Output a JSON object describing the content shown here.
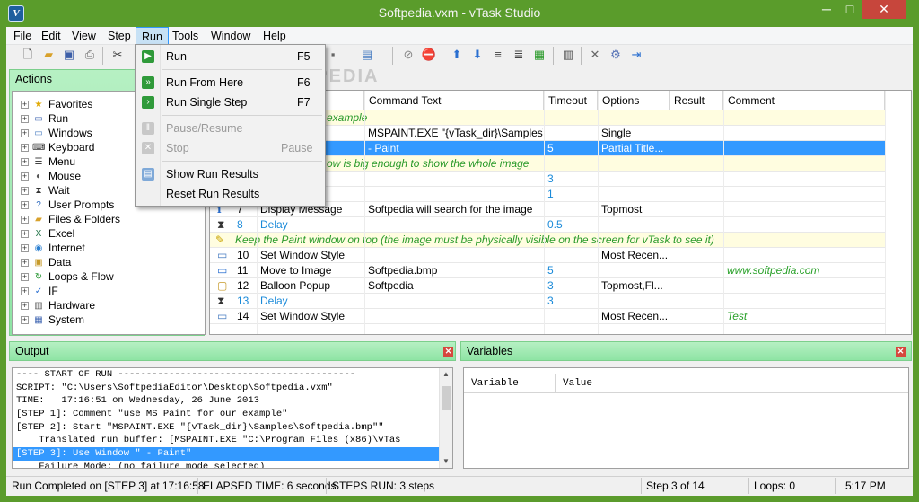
{
  "window": {
    "title": "Softpedia.vxm - vTask Studio",
    "min": "─",
    "max": "□",
    "close": "✕"
  },
  "menubar": [
    "File",
    "Edit",
    "View",
    "Step",
    "Run",
    "Tools",
    "Window",
    "Help"
  ],
  "run_menu": {
    "items": [
      {
        "label": "Run",
        "key": "F5"
      },
      {
        "label": "Run From Here",
        "key": "F6"
      },
      {
        "label": "Run Single Step",
        "key": "F7"
      },
      {
        "label": "Pause/Resume",
        "key": ""
      },
      {
        "label": "Stop",
        "key": "Pause"
      },
      {
        "label": "Show Run Results",
        "key": ""
      },
      {
        "label": "Reset Run Results",
        "key": ""
      }
    ]
  },
  "actions": {
    "title": "Actions",
    "items": [
      "Favorites",
      "Run",
      "Windows",
      "Keyboard",
      "Menu",
      "Mouse",
      "Wait",
      "User Prompts",
      "Files & Folders",
      "Excel",
      "Internet",
      "Data",
      "Loops & Flow",
      "IF",
      "Hardware",
      "System"
    ]
  },
  "grid": {
    "headers": [
      "Command Text",
      "Timeout",
      "Options",
      "Result",
      "Comment"
    ],
    "rows": [
      {
        "type": "comment",
        "text": "example"
      },
      {
        "num": "",
        "name": "",
        "cmd": "MSPAINT.EXE \"{vTask_dir}\\Samples\\...",
        "timeout": "",
        "options": "Single",
        "result": "",
        "comment": ""
      },
      {
        "num": "",
        "name": "",
        "cmd": " - Paint",
        "timeout": "5",
        "options": "Partial Title...",
        "result": "",
        "comment": "",
        "selected": true
      },
      {
        "type": "comment",
        "text": "ow is big enough to show the whole image"
      },
      {
        "num": "",
        "name": "",
        "cmd": "",
        "timeout": "3",
        "options": "",
        "result": "",
        "comment": ""
      },
      {
        "num": "",
        "name": "",
        "cmd": "",
        "timeout": "1",
        "options": "",
        "result": "",
        "comment": "",
        "blue": true
      },
      {
        "num": "7",
        "name": "Display Message",
        "cmd": "Softpedia will search for the image",
        "timeout": "",
        "options": "Topmost",
        "result": "",
        "comment": ""
      },
      {
        "num": "8",
        "name": "Delay",
        "cmd": "",
        "timeout": "0.5",
        "options": "",
        "result": "",
        "comment": "",
        "blue": true
      },
      {
        "type": "comment",
        "text": "Keep the Paint window on top (the image must be physically visible on the screen for vTask to see it)"
      },
      {
        "num": "10",
        "name": "Set Window Style",
        "cmd": "",
        "timeout": "",
        "options": "Most Recen...",
        "result": "",
        "comment": ""
      },
      {
        "num": "11",
        "name": "Move to Image",
        "cmd": "Softpedia.bmp",
        "timeout": "5",
        "options": "",
        "result": "",
        "comment": "www.softpedia.com"
      },
      {
        "num": "12",
        "name": "Balloon Popup",
        "cmd": "Softpedia",
        "timeout": "3",
        "options": "Topmost,Fl...",
        "result": "",
        "comment": ""
      },
      {
        "num": "13",
        "name": "Delay",
        "cmd": "",
        "timeout": "3",
        "options": "",
        "result": "",
        "comment": "",
        "blue": true
      },
      {
        "num": "14",
        "name": "Set Window Style",
        "cmd": "",
        "timeout": "",
        "options": "Most Recen...",
        "result": "",
        "comment": "Test"
      }
    ]
  },
  "output": {
    "title": "Output",
    "lines": [
      "---- START OF RUN ------------------------------------------",
      "SCRIPT: \"C:\\Users\\SoftpediaEditor\\Desktop\\Softpedia.vxm\"",
      "TIME:   17:16:51 on Wednesday, 26 June 2013",
      "[STEP 1]: Comment \"use MS Paint for our example\"",
      "[STEP 2]: Start \"MSPAINT.EXE \"{vTask_dir}\\Samples\\Softpedia.bmp\"\"",
      "    Translated run buffer: [MSPAINT.EXE \"C:\\Program Files (x86)\\vTas",
      "[STEP 3]: Use Window \" - Paint\"",
      "    Failure Mode: (no failure mode selected)"
    ],
    "selected_line": 6
  },
  "variables": {
    "title": "Variables",
    "col1": "Variable",
    "col2": "Value"
  },
  "status": {
    "message": "Run Completed on [STEP 3] at 17:16:58",
    "elapsed": "ELAPSED TIME: 6 seconds",
    "steps_run": "STEPS RUN: 3 steps",
    "step_of": "Step 3 of 14",
    "loops": "Loops: 0",
    "clock": "5:17 PM"
  },
  "watermark": "SOFTPEDIA"
}
